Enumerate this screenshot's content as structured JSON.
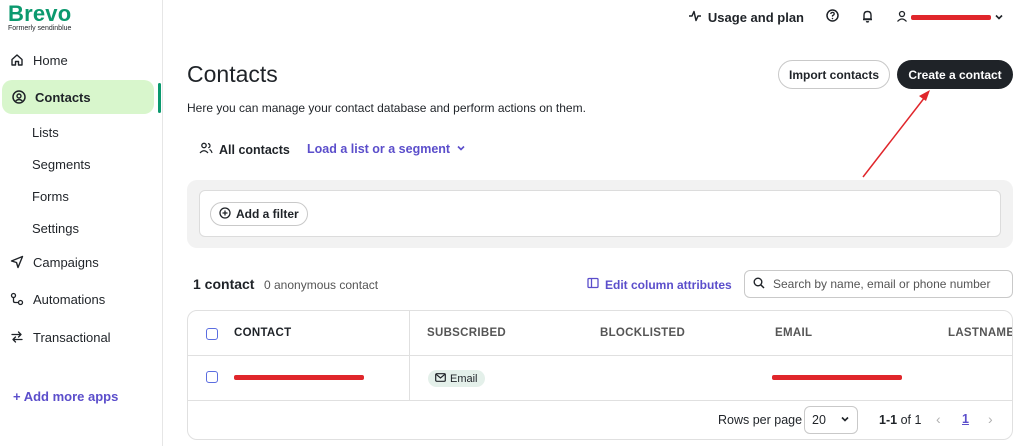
{
  "brand": {
    "name": "Brevo",
    "formerly": "Formerly sendinblue",
    "color": "#0b996e"
  },
  "sidebar": {
    "items": [
      {
        "label": "Home",
        "icon": "home-icon"
      },
      {
        "label": "Contacts",
        "icon": "user-circle-icon",
        "active": true
      },
      {
        "label": "Campaigns",
        "icon": "send-icon"
      },
      {
        "label": "Automations",
        "icon": "automation-icon"
      },
      {
        "label": "Transactional",
        "icon": "transfer-icon"
      }
    ],
    "sub_items": [
      "Lists",
      "Segments",
      "Forms",
      "Settings"
    ],
    "add_apps": "+ Add more apps"
  },
  "topbar": {
    "usage": "Usage and plan",
    "help_icon": "help-icon",
    "bell_icon": "bell-icon"
  },
  "header": {
    "title": "Contacts",
    "description": "Here you can manage your contact database and perform actions on them.",
    "import_label": "Import contacts",
    "create_label": "Create a contact"
  },
  "tabs": {
    "all": "All contacts",
    "load": "Load a list or a segment"
  },
  "filter": {
    "add_label": "Add a filter"
  },
  "summary": {
    "count": "1 contact",
    "anonymous": "0 anonymous contact",
    "edit_columns": "Edit column attributes",
    "search_placeholder": "Search by name, email or phone number"
  },
  "table": {
    "columns": [
      "CONTACT",
      "SUBSCRIBED",
      "BLOCKLISTED",
      "EMAIL",
      "LASTNAME"
    ],
    "rows": [
      {
        "subscribed": "Email"
      }
    ]
  },
  "pager": {
    "rows_label": "Rows per page",
    "rows_value": "20",
    "range_bold": "1-1",
    "range_rest": "of 1",
    "page": "1"
  },
  "colors": {
    "accent": "#5b4ecb",
    "active_bg": "#d8f6cc",
    "dark_button": "#1f2328",
    "redaction": "#e0262b"
  }
}
